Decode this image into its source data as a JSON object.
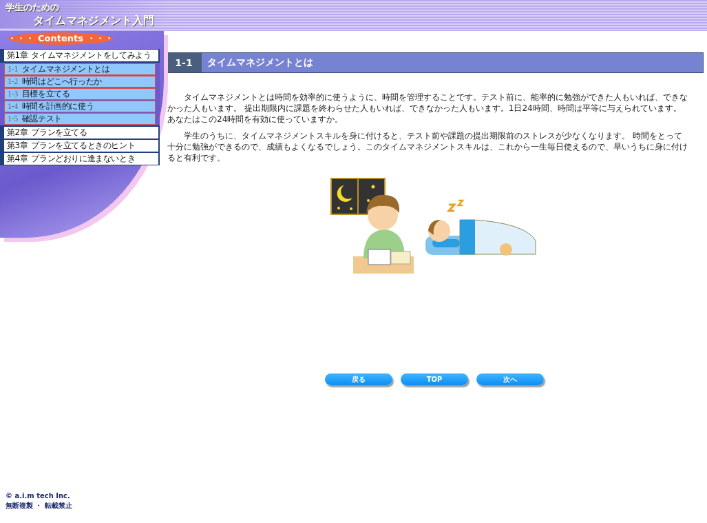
{
  "header": {
    "subtitle": "学生のための",
    "title": "タイムマネジメント入門",
    "contents_label": "・・・ Contents ・・・"
  },
  "nav": {
    "chapters": [
      {
        "label": "第1章",
        "title": "タイムマネジメントをしてみよう",
        "children": [
          {
            "number": "1-1",
            "title": "タイムマネジメントとは"
          },
          {
            "number": "1-2",
            "title": "時間はどこへ行ったか"
          },
          {
            "number": "1-3",
            "title": "目標を立てる"
          },
          {
            "number": "1-4",
            "title": "時間を計画的に使う"
          },
          {
            "number": "1-5",
            "title": "確認テスト"
          }
        ]
      },
      {
        "label": "第2章",
        "title": "プランを立てる"
      },
      {
        "label": "第3章",
        "title": "プランを立てるときのヒント"
      },
      {
        "label": "第4章",
        "title": "プランどおりに進まないとき"
      }
    ]
  },
  "section": {
    "number": "1-1",
    "title": "タイムマネジメントとは",
    "paragraphs": [
      "タイムマネジメントとは時間を効率的に使うように、時間を管理することです。テスト前に、能率的に勉強ができた人もいれば、できなかった人もいます。 提出期限内に課題を終わらせた人もいれば、できなかった人もいます。1日24時間、時間は平等に与えられています。あなたはこの24時間を有効に使っていますか。",
      "学生のうちに、タイムマネジメントスキルを身に付けると、テスト前や課題の提出期限前のストレスが少なくなります。 時間をとって十分に勉強ができるので、成績もよくなるでしょう。このタイムマネジメントスキルは、これから一生毎日使えるので、早いうちに身に付けると有利です。"
    ]
  },
  "buttons": [
    "戻る",
    "TOP",
    "次へ"
  ],
  "footer": {
    "copyright": "© a.i.m tech Inc.",
    "notice": "無断複製 ・ 転載禁止"
  }
}
